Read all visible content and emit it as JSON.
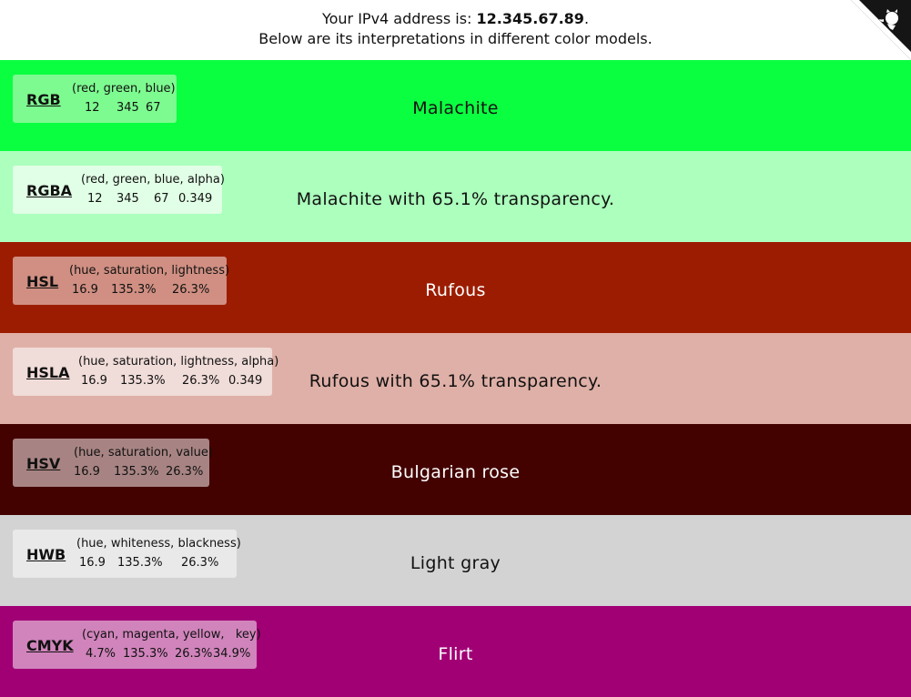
{
  "header": {
    "prefix": "Your IPv4 address is: ",
    "ip": "12.345.67.89",
    "suffix": ".",
    "line2": "Below are its interpretations in different color models."
  },
  "corner_icon": "github-octocat-icon",
  "rows": [
    {
      "code": "RGB",
      "legend": "(red, green, blue)",
      "values": [
        "12",
        "345",
        "67"
      ],
      "name": "Malachite",
      "bg": "#0bff41",
      "box": "#7dfb90",
      "text": "#111111"
    },
    {
      "code": "RGBA",
      "legend": "(red, green, blue, alpha)",
      "values": [
        "12",
        "345",
        "67",
        "0.349"
      ],
      "name": "Malachite with 65.1% transparency.",
      "bg": "#acffbd",
      "box": "#e1ffe6",
      "text": "#111111"
    },
    {
      "code": "HSL",
      "legend": "(hue, saturation, lightness)",
      "values": [
        "16.9",
        "135.3%",
        "26.3%"
      ],
      "name": "Rufous",
      "bg": "#9c1c01",
      "box": "#d08f82",
      "text": "#ffffff"
    },
    {
      "code": "HSLA",
      "legend": "(hue, saturation, lightness, alpha)",
      "values": [
        "16.9",
        "135.3%",
        "26.3%",
        "0.349"
      ],
      "name": "Rufous with 65.1% transparency.",
      "bg": "#dfb0a7",
      "box": "#f0dcd8",
      "text": "#111111"
    },
    {
      "code": "HSV",
      "legend": "(hue, saturation, value)",
      "values": [
        "16.9",
        "135.3%",
        "26.3%"
      ],
      "name": "Bulgarian rose",
      "bg": "#430200",
      "box": "#a78483",
      "text": "#ffffff"
    },
    {
      "code": "HWB",
      "legend": "(hue, whiteness, blackness)",
      "values": [
        "16.9",
        "135.3%",
        "26.3%"
      ],
      "name": "Light gray",
      "bg": "#d3d3d3",
      "box": "#e9e9e9",
      "text": "#111111"
    },
    {
      "code": "CMYK",
      "legend": "(cyan, magenta, yellow,   key)",
      "values": [
        "4.7%",
        "135.3%",
        "26.3%",
        "34.9%"
      ],
      "name": "Flirt",
      "bg": "#a10075",
      "box": "#d084bb",
      "text": "#ffffff"
    }
  ]
}
